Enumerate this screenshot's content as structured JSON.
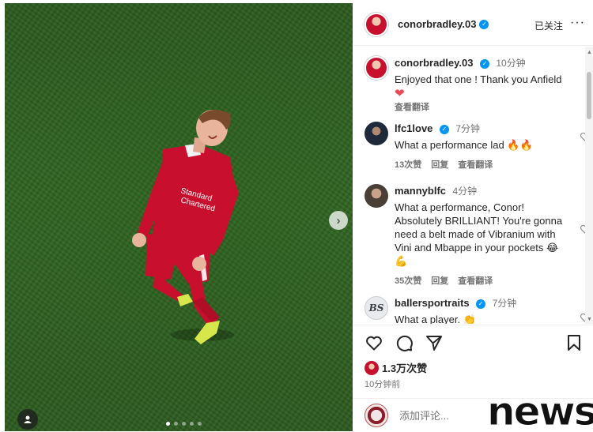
{
  "post": {
    "author": "conorbradley.03",
    "follow_status": "已关注",
    "more_icon": "more-horizontal-icon"
  },
  "comments": [
    {
      "user": "conorbradley.03",
      "verified": true,
      "time": "10分钟",
      "text": "Enjoyed that one ! Thank you Anfield",
      "emoji": "❤",
      "translate": "查看翻译"
    },
    {
      "user": "lfc1love",
      "verified": true,
      "time": "7分钟",
      "text": "What a performance lad 🔥🔥",
      "likes": "13次赞",
      "reply": "回复",
      "translate": "查看翻译"
    },
    {
      "user": "mannyblfc",
      "verified": false,
      "time": "4分钟",
      "text": "What a performance, Conor! Absolutely BRILLIANT! You're gonna need a belt made of Vibranium with Vini and Mbappe in your pockets 😂💪",
      "likes": "35次赞",
      "reply": "回复",
      "translate": "查看翻译"
    },
    {
      "user": "ballersportraits",
      "verified": true,
      "time": "7分钟",
      "text": "What a player. 👏",
      "avatar_text": "BS"
    }
  ],
  "actions": {
    "like_icon": "heart-icon",
    "comment_icon": "comment-icon",
    "share_icon": "send-icon",
    "save_icon": "bookmark-icon",
    "likes_count": "1.3万次赞",
    "posted_time": "10分钟前"
  },
  "add_comment": {
    "placeholder": "添加评论..."
  },
  "carousel": {
    "current": 1,
    "total": 5,
    "next_icon": "chevron-right-icon",
    "tag_icon": "user-tag-icon"
  },
  "watermark": "news",
  "colors": {
    "verified": "#0095f6",
    "liverpool_red": "#c8102e",
    "grass": "#2f6421",
    "like_red": "#ed4956"
  }
}
